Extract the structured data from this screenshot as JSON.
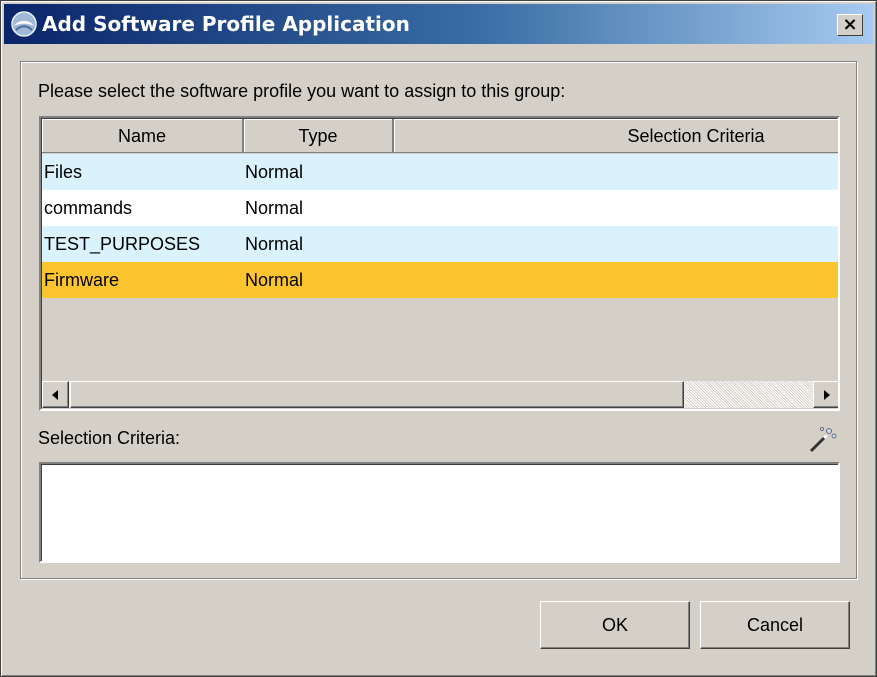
{
  "window": {
    "title": "Add Software Profile Application",
    "close_label": "×",
    "icon": "app-globe-icon"
  },
  "prompt": "Please select the software profile you want to assign to this group:",
  "table": {
    "columns": [
      "Name",
      "Type",
      "Selection Criteria"
    ],
    "rows": [
      {
        "name": "Files",
        "type": "Normal",
        "criteria": ""
      },
      {
        "name": "commands",
        "type": "Normal",
        "criteria": ""
      },
      {
        "name": "TEST_PURPOSES",
        "type": "Normal",
        "criteria": ""
      },
      {
        "name": "Firmware",
        "type": "Normal",
        "criteria": "",
        "selected": true
      }
    ]
  },
  "criteria": {
    "label": "Selection Criteria:",
    "value": "",
    "edit_icon": "magic-wand-icon"
  },
  "buttons": {
    "ok": "OK",
    "cancel": "Cancel"
  },
  "colors": {
    "row_alt": "#d9f2fb",
    "row_selected": "#fcc42e",
    "title_start": "#0a246a",
    "title_end": "#a6caf0"
  }
}
